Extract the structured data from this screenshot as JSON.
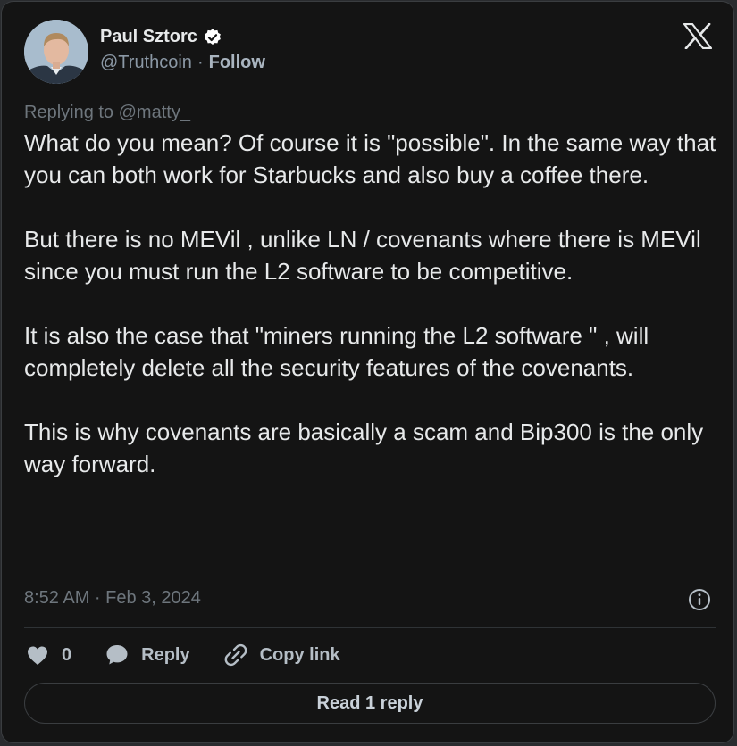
{
  "author": {
    "name": "Paul Sztorc",
    "handle": "@Truthcoin",
    "separator": "·",
    "follow_label": "Follow"
  },
  "tweet": {
    "replying_to": "Replying to @matty_",
    "paragraphs": [
      "What do you mean? Of course it is \"possible\". In the same way that you can both work for Starbucks and also buy a coffee there.",
      "But there is no MEVil , unlike LN / covenants where there is MEVil since you must run the L2 software to be competitive.",
      "It is also the case that \"miners running the L2 software \" , will completely delete all the security features of the covenants.",
      "This is why covenants are basically a scam and Bip300 is the only way forward."
    ],
    "timestamp": "8:52 AM · Feb 3, 2024"
  },
  "actions": {
    "like_count": "0",
    "reply_label": "Reply",
    "copy_link_label": "Copy link"
  },
  "read_reply_label": "Read 1 reply",
  "colors": {
    "background": "#141414",
    "text_primary": "#e7e9ea",
    "text_secondary": "#6e767d",
    "verified": "#ffffff"
  }
}
